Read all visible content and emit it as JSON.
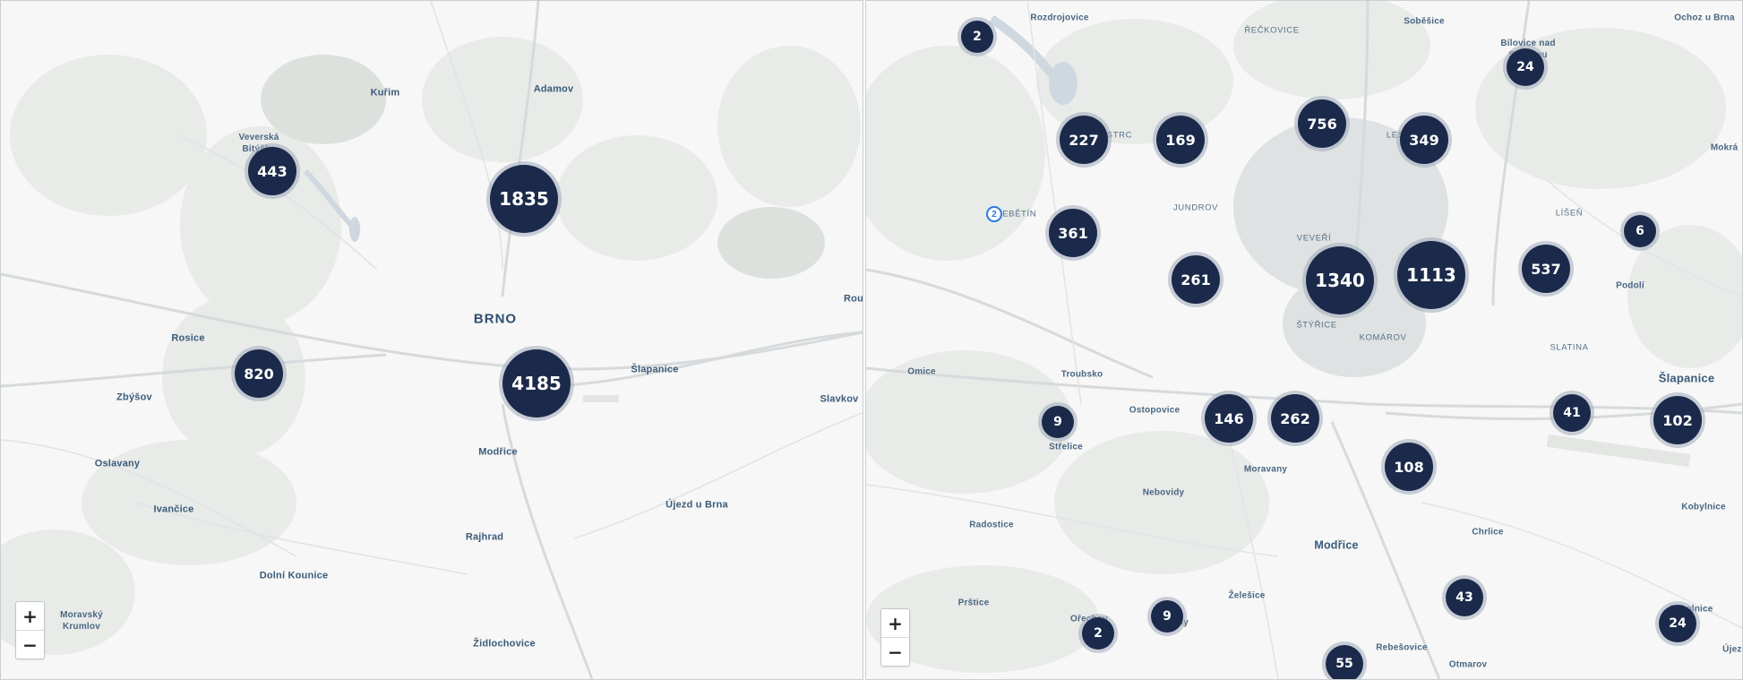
{
  "left_map": {
    "labels": [
      {
        "text": "Kuřim"
      },
      {
        "text": "Adamov"
      },
      {
        "text": "Veverská\nBitýška"
      },
      {
        "text": "BRNO"
      },
      {
        "text": "Rosice"
      },
      {
        "text": "Zbýšov"
      },
      {
        "text": "Šlapanice"
      },
      {
        "text": "Slavkov"
      },
      {
        "text": "Rou"
      },
      {
        "text": "Oslavany"
      },
      {
        "text": "Modřice"
      },
      {
        "text": "Ivančice"
      },
      {
        "text": "Újezd u Brna"
      },
      {
        "text": "Rajhrad"
      },
      {
        "text": "Dolní Kounice"
      },
      {
        "text": "Moravský\nKrumlov"
      },
      {
        "text": "Židlochovice"
      }
    ],
    "clusters": [
      {
        "count": "443"
      },
      {
        "count": "1835"
      },
      {
        "count": "820"
      },
      {
        "count": "4185"
      }
    ],
    "zoom_in": "+",
    "zoom_out": "−"
  },
  "right_map": {
    "labels": [
      {
        "text": "Rozdrojovice"
      },
      {
        "text": "ŘEČKOVICE"
      },
      {
        "text": "Soběšice"
      },
      {
        "text": "Ochoz u Brna"
      },
      {
        "text": "Bílovice nad\nSvitavou"
      },
      {
        "text": "BYSTRC"
      },
      {
        "text": "LESNÁ"
      },
      {
        "text": "ŽEBĚTÍN"
      },
      {
        "text": "JUNDROV"
      },
      {
        "text": "LÍŠEŇ"
      },
      {
        "text": "Mokrá"
      },
      {
        "text": "VEVEŘÍ"
      },
      {
        "text": "Podolí"
      },
      {
        "text": "ŠTÝŘICE"
      },
      {
        "text": "KOMÁROV"
      },
      {
        "text": "SLATINA"
      },
      {
        "text": "Omice"
      },
      {
        "text": "Troubsko"
      },
      {
        "text": "Šlapanice"
      },
      {
        "text": "Ostopovice"
      },
      {
        "text": "Střelice"
      },
      {
        "text": "Moravany"
      },
      {
        "text": "Nebovidy"
      },
      {
        "text": "Radostice"
      },
      {
        "text": "Kobylnice"
      },
      {
        "text": "Chrlice"
      },
      {
        "text": "Modřice"
      },
      {
        "text": "Želešice"
      },
      {
        "text": "Prštice"
      },
      {
        "text": "Hajany"
      },
      {
        "text": "Ořechov"
      },
      {
        "text": "Rebešovice"
      },
      {
        "text": "Otmarov"
      },
      {
        "text": "Sokolnice"
      },
      {
        "text": "Újezd"
      }
    ],
    "clusters": [
      {
        "count": "2"
      },
      {
        "count": "24"
      },
      {
        "count": "227"
      },
      {
        "count": "169"
      },
      {
        "count": "756"
      },
      {
        "count": "349"
      },
      {
        "count": "361"
      },
      {
        "count": "6"
      },
      {
        "count": "261"
      },
      {
        "count": "1340"
      },
      {
        "count": "1113"
      },
      {
        "count": "537"
      },
      {
        "count": "9"
      },
      {
        "count": "146"
      },
      {
        "count": "262"
      },
      {
        "count": "41"
      },
      {
        "count": "102"
      },
      {
        "count": "108"
      },
      {
        "count": "43"
      },
      {
        "count": "9"
      },
      {
        "count": "2"
      },
      {
        "count": "24"
      },
      {
        "count": "55"
      }
    ],
    "marker": {
      "count": "2",
      "color": "#2a7be0"
    },
    "zoom_in": "+",
    "zoom_out": "−"
  },
  "colors": {
    "cluster_fill": "#1b2a4a",
    "cluster_ring": "#a0aabc",
    "label": "#3b5a7a",
    "background": "#f6f7f6",
    "water": "#cfd8e0"
  }
}
